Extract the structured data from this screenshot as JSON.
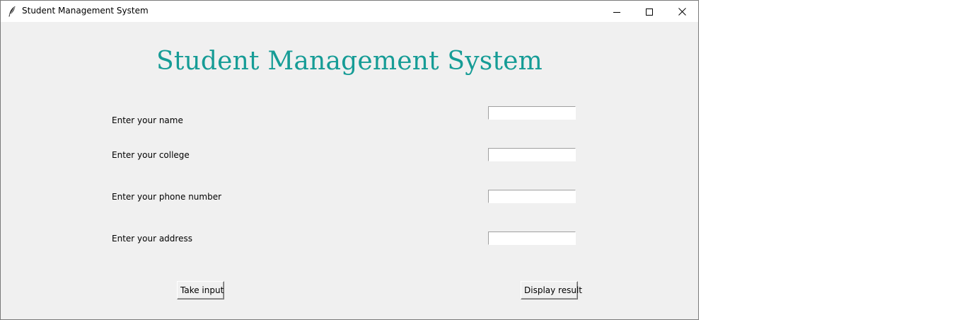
{
  "window": {
    "title": "Student Management System",
    "controls": {
      "minimize": "minimize-icon",
      "maximize": "maximize-icon",
      "close": "close-icon"
    }
  },
  "main": {
    "heading": "Student Management System",
    "fields": [
      {
        "label": "Enter your name",
        "value": ""
      },
      {
        "label": "Enter your college",
        "value": ""
      },
      {
        "label": "Enter your phone number",
        "value": ""
      },
      {
        "label": "Enter your address",
        "value": ""
      }
    ],
    "buttons": {
      "take_input": "Take input",
      "display_result": "Display result"
    }
  },
  "colors": {
    "heading": "#169c96",
    "background": "#f0f0f0",
    "titlebar": "#ffffff"
  }
}
